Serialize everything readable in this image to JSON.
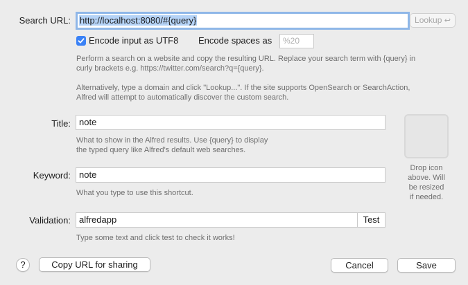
{
  "search_url": {
    "label": "Search URL:",
    "value": "http://localhost:8080/#{query}",
    "lookup_button": "Lookup",
    "lookup_icon": "return-arrow-icon"
  },
  "encoding": {
    "utf8_label": "Encode input as UTF8",
    "utf8_checked": true,
    "spaces_label": "Encode spaces as",
    "spaces_placeholder": "%20"
  },
  "url_help": "Perform a search on a website and copy the resulting URL. Replace your search term with {query} in\ncurly brackets e.g. https://twitter.com/search?q={query}.\n\nAlternatively, type a domain and click \"Lookup...\". If the site supports OpenSearch or SearchAction,\nAlfred will attempt to automatically discover the custom search.",
  "title": {
    "label": "Title:",
    "value": "note",
    "help": "What to show in the Alfred results. Use {query} to display\nthe typed query like Alfred's default web searches."
  },
  "icon_well": {
    "help": "Drop icon\nabove. Will\nbe resized\nif needed."
  },
  "keyword": {
    "label": "Keyword:",
    "value": "note",
    "help": "What you type to use this shortcut."
  },
  "validation": {
    "label": "Validation:",
    "value": "alfredapp",
    "test_button": "Test",
    "help": "Type some text and click test to check it works!"
  },
  "footer": {
    "help_button": "?",
    "copy_button": "Copy URL for sharing",
    "cancel_button": "Cancel",
    "save_button": "Save"
  },
  "colors": {
    "background": "#ececec",
    "accent": "#3b82f6",
    "focus_ring": "#8fb7e8",
    "selection": "#b5d3f7"
  }
}
